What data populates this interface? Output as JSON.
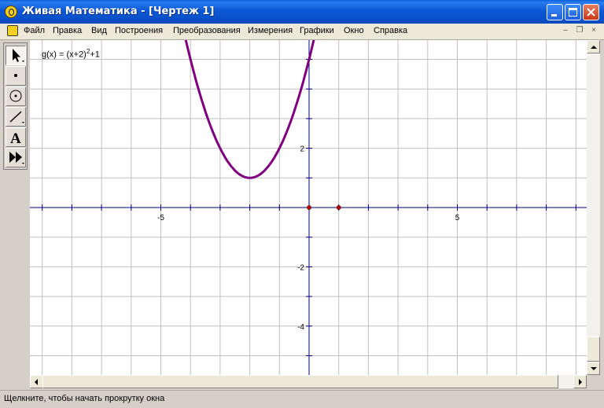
{
  "window": {
    "title": "Живая Математика - [Чертеж 1]"
  },
  "menu": [
    "Файл",
    "Правка",
    "Вид",
    "Построения",
    "Преобразования",
    "Измерения",
    "Графики",
    "Окно",
    "Справка"
  ],
  "toolbox": [
    "arrow-select-tool",
    "point-tool",
    "compass-circle-tool",
    "straightedge-tool",
    "text-tool",
    "custom-tool"
  ],
  "graph": {
    "function_label": {
      "pre": "g(x) = (x+2)",
      "exp": "2",
      "post": "+1"
    },
    "x_ticks": [
      "-5",
      "5"
    ],
    "y_ticks": [
      "2",
      "-2",
      "-4"
    ],
    "curve_color": "#800080",
    "axis_color": "#000080",
    "grid_color": "#c0c0c0",
    "point_color": "#c00000"
  },
  "chart_data": {
    "type": "line",
    "title": "",
    "function": "g(x) = (x+2)^2+1",
    "series": [
      {
        "x": [
          -4.1,
          -3.5,
          -3,
          -2.5,
          -2,
          -1.5,
          -1,
          -0.5,
          -0.1
        ],
        "y": [
          5.41,
          3.25,
          2,
          1.25,
          1,
          1.25,
          2,
          3.25,
          4.61
        ]
      }
    ],
    "vertex": [
      -2,
      1
    ],
    "points": [
      [
        0,
        0
      ],
      [
        1,
        0
      ]
    ],
    "xlim": [
      -9.4,
      9.4
    ],
    "ylim": [
      -5.5,
      5.8
    ],
    "grid": true
  },
  "status": "Щелкните, чтобы начать прокрутку окна"
}
